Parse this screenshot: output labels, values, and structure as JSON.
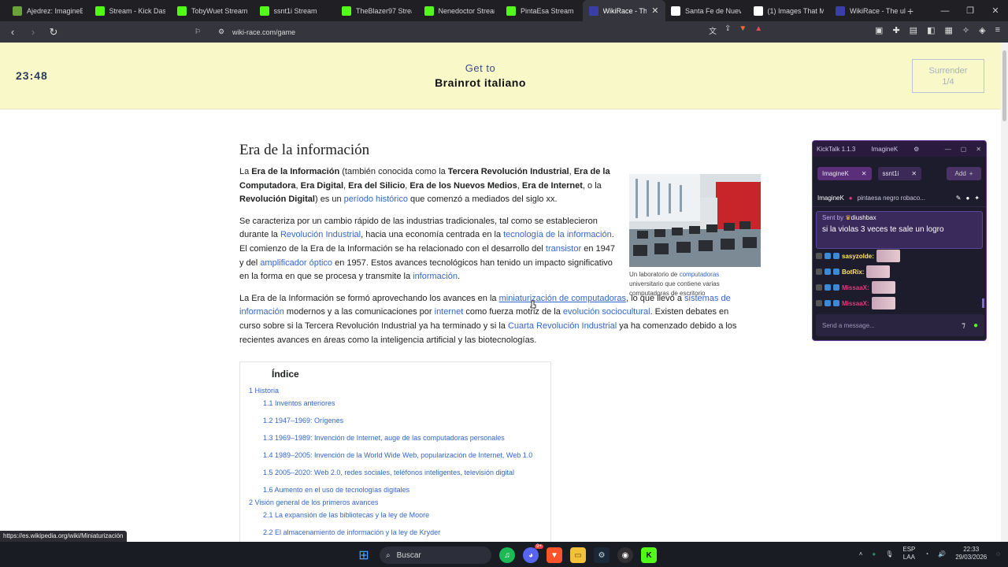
{
  "tabs": [
    {
      "title": "Ajedrez: ImagineBv",
      "icon": "chess-pawn-icon",
      "color": "#6aa33a"
    },
    {
      "title": "Stream - Kick Dashb",
      "icon": "kick-icon",
      "color": "#53fc18"
    },
    {
      "title": "TobyWuet Stream",
      "icon": "kick-icon",
      "color": "#53fc18"
    },
    {
      "title": "ssnt1i Stream",
      "icon": "kick-icon",
      "color": "#53fc18"
    },
    {
      "title": "TheBlazer97 Stream",
      "icon": "kick-icon",
      "color": "#53fc18"
    },
    {
      "title": "Nenedoctor Stream",
      "icon": "kick-icon",
      "color": "#53fc18"
    },
    {
      "title": "PintaEsa Stream",
      "icon": "kick-icon",
      "color": "#53fc18"
    },
    {
      "title": "WikiRace - The",
      "icon": "wikirace-icon",
      "color": "#3a3fa8",
      "active": true
    },
    {
      "title": "Santa Fe de Nuevo",
      "icon": "wikipedia-icon",
      "color": "#ffffff"
    },
    {
      "title": "(1) Images That Ma",
      "icon": "x-icon",
      "color": "#ffffff"
    },
    {
      "title": "WikiRace - The ultim",
      "icon": "wikirace-icon",
      "color": "#3a3fa8"
    }
  ],
  "address": {
    "url": "wiki-race.com/game",
    "brave_badge": "3"
  },
  "game": {
    "timer": "23:48",
    "goal_label": "Get to",
    "goal_target": "Brainrot italiano",
    "surrender_label": "Surrender",
    "surrender_count": "1/4"
  },
  "article": {
    "title": "Era de la información",
    "image_caption_pre": "Un laboratorio de ",
    "image_caption_link": "computadoras",
    "image_caption_post": " universitario que contiene varias computadoras de escritorio"
  },
  "toc": {
    "title": "Índice",
    "items": [
      {
        "label": "1 Historia",
        "level": 1
      },
      {
        "label": "1.1 Inventos anteriores",
        "level": 2
      },
      {
        "label": "1.2 1947–1969: Orígenes",
        "level": 2
      },
      {
        "label": "1.3 1969–1989: Invención de Internet, auge de las computadoras personales",
        "level": 2
      },
      {
        "label": "1.4 1989–2005: Invención de la World Wide Web, popularización de Internet, Web 1.0",
        "level": 2
      },
      {
        "label": "1.5 2005–2020: Web 2.0, redes sociales, teléfonos inteligentes, televisión digital",
        "level": 2
      },
      {
        "label": "1.6 Aumento en el uso de tecnologías digitales",
        "level": 2
      },
      {
        "label": "2 Visión general de los primeros avances",
        "level": 1
      },
      {
        "label": "2.1 La expansión de las bibliotecas y la ley de Moore",
        "level": 2
      },
      {
        "label": "2.2 El almacenamiento de información y la ley de Kryder",
        "level": 2
      }
    ]
  },
  "kicktalk": {
    "app_title": "KickTalk 1.1.3",
    "user": "ImagineK",
    "tabs": [
      "ImagineK",
      "ssnt1i"
    ],
    "add_label": "Add",
    "channel_user": "ImagineK",
    "channel_message": "pintaesa negro robaco...",
    "sent_by_label": "Sent by",
    "sent_by_user": "diushbax",
    "sent_message": "si la violas 3 veces te sale un logro",
    "chat": [
      {
        "name": "sasyzolde:",
        "color": "#ffe566"
      },
      {
        "name": "BotRix:",
        "color": "#ffe566"
      },
      {
        "name": "MissaaX:",
        "color": "#e6397a"
      },
      {
        "name": "MissaaX:",
        "color": "#e6397a"
      }
    ],
    "input_placeholder": "Send a message..."
  },
  "status_url": "https://es.wikipedia.org/wiki/Miniaturización",
  "taskbar": {
    "search_placeholder": "Buscar",
    "discord_badge": "9+",
    "lang_top": "ESP",
    "lang_bottom": "LAA",
    "time": "22:33",
    "date": "29/03/2026"
  }
}
